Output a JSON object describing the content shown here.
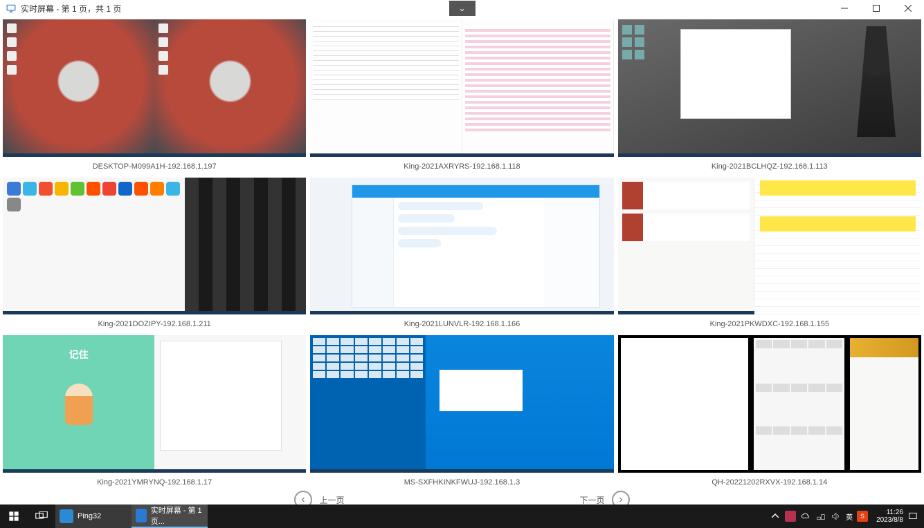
{
  "window": {
    "title": "实时屏幕 - 第 1 页，共 1 页",
    "dropdown_glyph": "⌄"
  },
  "cells": [
    {
      "label": "DESKTOP-M099A1H-192.168.1.197"
    },
    {
      "label": "King-2021AXRYRS-192.168.1.118"
    },
    {
      "label": "King-2021BCLHQZ-192.168.1.113"
    },
    {
      "label": "King-2021DOZIPY-192.168.1.211"
    },
    {
      "label": "King-2021LUNVLR-192.168.1.166"
    },
    {
      "label": "King-2021PKWDXC-192.168.1.155"
    },
    {
      "label": "King-2021YMRYNQ-192.168.1.17"
    },
    {
      "label": "MS-SXFHKINKFWUJ-192.168.1.3"
    },
    {
      "label": "QH-20221202RXVX-192.168.1.14"
    }
  ],
  "pager": {
    "prev": "上一页",
    "next": "下一页"
  },
  "thumb_overlay": {
    "t6_text": "记住"
  },
  "taskbar": {
    "app1": {
      "name": "Ping32"
    },
    "app2": {
      "name": "实时屏幕 - 第 1 页..."
    },
    "ime": "英",
    "time": "11:26",
    "date": "2023/8/8"
  },
  "icons": {
    "monitor": "monitor-icon",
    "chevron_down": "chevron-down-icon",
    "minimize": "minimize-icon",
    "maximize": "maximize-icon",
    "close": "close-icon",
    "arrow_left": "arrow-left-icon",
    "arrow_right": "arrow-right-icon",
    "start": "windows-start-icon",
    "taskview": "task-view-icon",
    "tray_up": "tray-expand-icon",
    "cloud": "cloud-icon",
    "network": "network-icon",
    "volume": "volume-icon",
    "sogou": "sogou-ime-icon",
    "msg": "notifications-icon"
  }
}
